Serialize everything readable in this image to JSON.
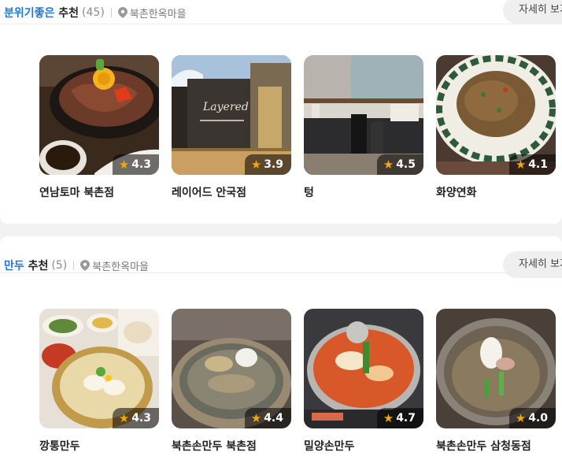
{
  "sections": [
    {
      "keyword": "분위기좋은",
      "suffix": " 추천",
      "count": "(45)",
      "location": "북촌한옥마을",
      "more_label": "자세히 보기",
      "cards": [
        {
          "name": "연남토마 북촌점",
          "rating": "4.3"
        },
        {
          "name": "레이어드 안국점",
          "rating": "3.9"
        },
        {
          "name": "텅",
          "rating": "4.5"
        },
        {
          "name": "화양연화",
          "rating": "4.1"
        }
      ]
    },
    {
      "keyword": "만두",
      "suffix": " 추천",
      "count": "(5)",
      "location": "북촌한옥마을",
      "more_label": "자세히 보기",
      "cards": [
        {
          "name": "깡통만두",
          "rating": "4.3"
        },
        {
          "name": "북촌손만두 북촌점",
          "rating": "4.4"
        },
        {
          "name": "밀양손만두",
          "rating": "4.7"
        },
        {
          "name": "북촌손만두 삼청동점",
          "rating": "4.0"
        }
      ]
    }
  ],
  "icons": {
    "location": "map-pin-icon",
    "rating": "star-icon"
  },
  "colors": {
    "keyword": "#1e78d8",
    "star": "#f7a600"
  }
}
